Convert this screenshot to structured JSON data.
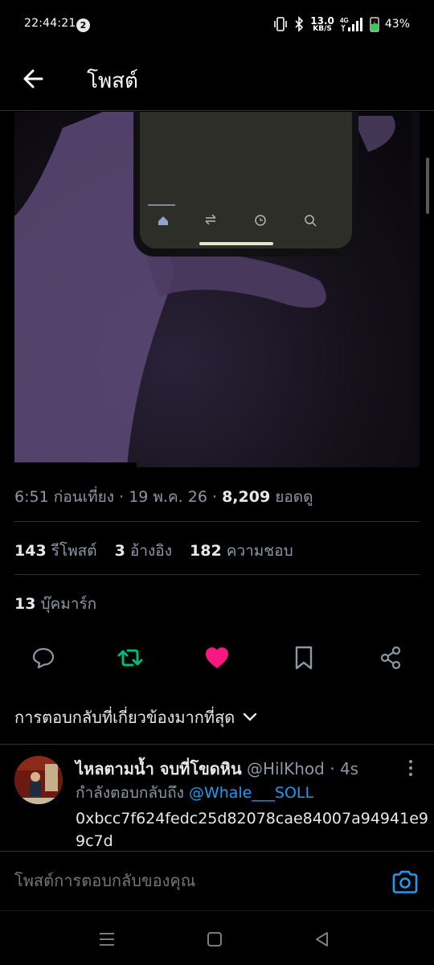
{
  "status_bar": {
    "time": "22:44:21",
    "notification_count": "2",
    "net_speed": "13.0",
    "net_unit": "KB/S",
    "network": "4G",
    "battery": "43%"
  },
  "header": {
    "title": "โพสต์"
  },
  "post": {
    "time": "6:51 ก่อนเที่ยง",
    "date": "19 พ.ค. 26",
    "views": "8,209",
    "views_label": "ยอดดู",
    "reposts": "143",
    "reposts_label": "รีโพสต์",
    "quotes": "3",
    "quotes_label": "อ้างอิง",
    "likes": "182",
    "likes_label": "ความชอบ",
    "bookmarks": "13",
    "bookmarks_label": "บุ๊คมาร์ก"
  },
  "actions": {
    "reply_icon": "speech-bubble-icon",
    "repost_icon": "repost-icon",
    "like_icon": "heart-icon",
    "bookmark_icon": "bookmark-icon",
    "share_icon": "share-icon",
    "repost_color": "#00ba7c",
    "like_color": "#f91880"
  },
  "sort": {
    "label": "การตอบกลับที่เกี่ยวข้องมากที่สุด"
  },
  "reply": {
    "name": "ไหลตามน้ำ จบที่โขดหิน",
    "handle": "@HilKhod",
    "age": "4s",
    "replying_to_label": "กำลังตอบกลับถึง",
    "replying_to": "@Whale___SOLL",
    "text": "0xbcc7f624fedc25d82078cae84007a94941e99c7d"
  },
  "composer": {
    "placeholder": "โพสต์การตอบกลับของคุณ"
  },
  "colors": {
    "accent": "#1d9bf0",
    "background": "#000000",
    "secondary_text": "#8b98a5"
  }
}
